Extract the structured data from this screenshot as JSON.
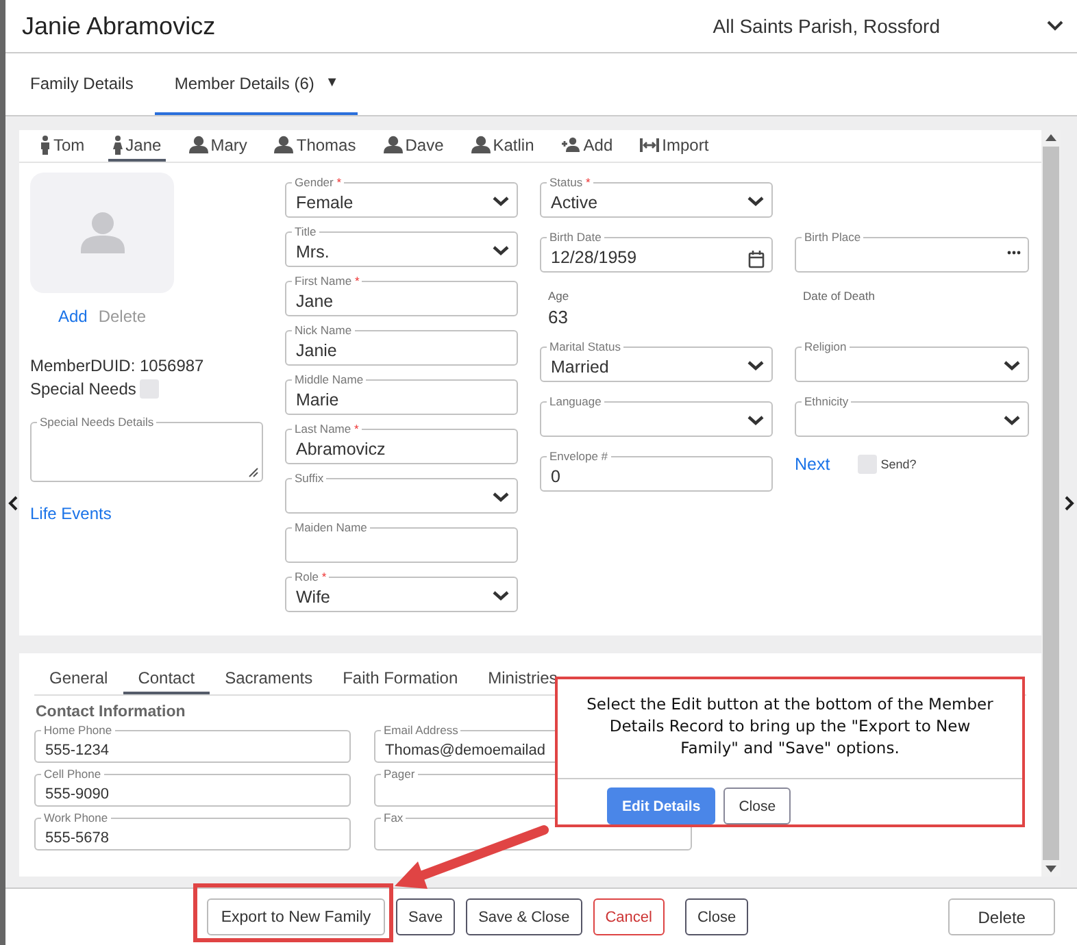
{
  "window": {
    "title": "Janie Abramovicz",
    "parish": "All Saints Parish, Rossford"
  },
  "nav_tabs": [
    {
      "label": "Family Details",
      "selected": false
    },
    {
      "label": "Member Details (6)",
      "selected": true,
      "caret": "▼"
    }
  ],
  "member_tabs": [
    {
      "label": "Tom",
      "kind": "male",
      "selected": false
    },
    {
      "label": "Jane",
      "kind": "female",
      "selected": true
    },
    {
      "label": "Mary",
      "kind": "bust",
      "selected": false
    },
    {
      "label": "Thomas",
      "kind": "bust",
      "selected": false
    },
    {
      "label": "Dave",
      "kind": "bust",
      "selected": false
    },
    {
      "label": "Katlin",
      "kind": "bust",
      "selected": false
    },
    {
      "label": "Add",
      "kind": "add",
      "selected": false
    },
    {
      "label": "Import",
      "kind": "import",
      "selected": false
    }
  ],
  "photo": {
    "add": "Add",
    "delete": "Delete"
  },
  "member_duid": "MemberDUID: 1056987",
  "special_needs": {
    "label": "Special Needs",
    "checked": false
  },
  "special_needs_details": {
    "label": "Special Needs Details"
  },
  "life_events": "Life Events",
  "columns": [
    [
      {
        "kind": "select",
        "label": "Gender",
        "mark": "*",
        "value": "Female"
      },
      {
        "kind": "select",
        "label": "Title",
        "value": "Mrs."
      },
      {
        "kind": "text",
        "label": "First Name",
        "mark": "*",
        "value": "Jane"
      },
      {
        "kind": "text",
        "label": "Nick Name",
        "value": "Janie"
      },
      {
        "kind": "text",
        "label": "Middle Name",
        "value": "Marie"
      },
      {
        "kind": "text",
        "label": "Last Name",
        "mark": "*",
        "value": "Abramovicz"
      },
      {
        "kind": "select",
        "label": "Suffix"
      },
      {
        "kind": "text",
        "label": "Maiden Name"
      },
      {
        "kind": "select",
        "label": "Role",
        "mark": "*",
        "value": "Wife"
      }
    ],
    [
      {
        "kind": "select",
        "label": "Status",
        "mark": "*",
        "value": "Active"
      },
      {
        "kind": "date",
        "label": "Birth Date",
        "value": "12/28/1959"
      },
      {
        "kind": "readout",
        "label": "Age",
        "value": "63"
      },
      {
        "kind": "select",
        "label": "Marital Status",
        "value": "Married"
      },
      {
        "kind": "select",
        "label": "Language"
      },
      {
        "kind": "text",
        "label": "Envelope #",
        "value": "0"
      }
    ],
    [
      {
        "kind": "spacer"
      },
      {
        "kind": "lookup",
        "label": "Birth Place"
      },
      {
        "kind": "readout",
        "label": "Date of Death"
      },
      {
        "kind": "select",
        "label": "Religion"
      },
      {
        "kind": "select",
        "label": "Ethnicity"
      },
      {
        "kind": "next",
        "link": "Next",
        "label": "Send?",
        "checked": false
      }
    ]
  ],
  "detail_tabs": [
    {
      "label": "General",
      "selected": false
    },
    {
      "label": "Contact",
      "selected": true
    },
    {
      "label": "Sacraments",
      "selected": false
    },
    {
      "label": "Faith Formation",
      "selected": false
    },
    {
      "label": "Ministries",
      "selected": false
    }
  ],
  "contact": {
    "heading": "Contact Information",
    "fields": [
      {
        "label": "Home Phone",
        "value": "555-1234"
      },
      {
        "label": "Email Address",
        "value": "Thomas@demoemailad"
      },
      {
        "label": "Cell Phone",
        "value": "555-9090"
      },
      {
        "label": "Pager"
      },
      {
        "label": "Work Phone",
        "value": "555-5678"
      },
      {
        "label": "Fax"
      }
    ]
  },
  "footer_buttons": [
    {
      "label": "Export to New Family",
      "kind": "plain"
    },
    {
      "label": "Save",
      "kind": "primary"
    },
    {
      "label": "Save & Close",
      "kind": "primary"
    },
    {
      "label": "Cancel",
      "kind": "danger"
    },
    {
      "label": "Close",
      "kind": "primary"
    },
    {
      "label": "Delete",
      "kind": "right"
    }
  ],
  "callout": {
    "text": "Select the Edit button at the bottom of the Member Details Record to bring up the \"Export to New Family\" and \"Save\" options.",
    "buttons": [
      {
        "label": "Edit Details",
        "kind": "primary"
      },
      {
        "label": "Close",
        "kind": "plain"
      }
    ]
  }
}
